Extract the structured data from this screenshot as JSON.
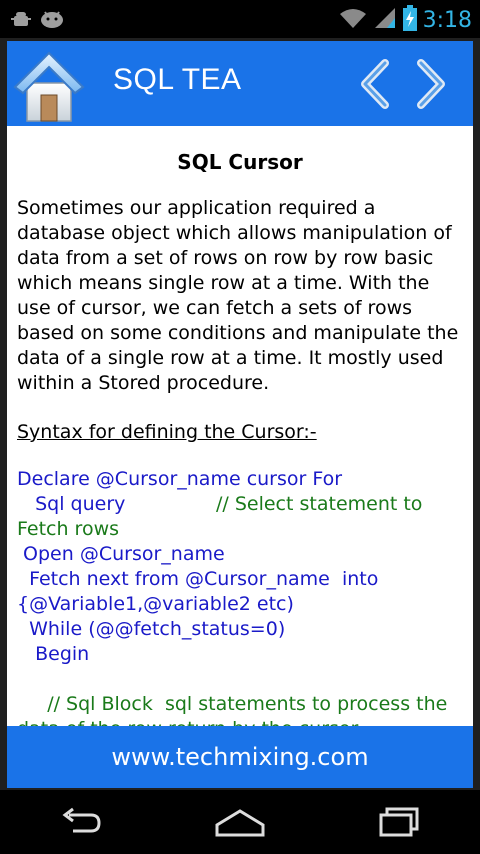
{
  "status_bar": {
    "time": "3:18",
    "icons": [
      "android-debug-icon",
      "android-icon",
      "wifi-icon",
      "signal-icon",
      "battery-charging-icon"
    ]
  },
  "header": {
    "title": "SQL TEA",
    "home_icon": "home-icon",
    "prev_icon": "chevron-left-icon",
    "next_icon": "chevron-right-icon"
  },
  "article": {
    "heading": "SQL Cursor",
    "paragraph_lines": [
      "Sometimes our application required a",
      "database object which allows manipulation of",
      "data from a set of rows on row by row basic",
      "which means single row at a time. With the",
      "use of cursor, we can fetch a sets of rows",
      "based on some conditions and manipulate the",
      "data of a single row at a time. It mostly used",
      "within a Stored procedure."
    ],
    "syntax_label": "Syntax for defining the Cursor:-",
    "code": {
      "line1": "Declare @Cursor_name cursor For",
      "line2_code": "   Sql query               ",
      "line2_comment": "// Select statement to",
      "line3_comment": "Fetch rows",
      "line4": " Open @Cursor_name",
      "line5": "  Fetch next from @Cursor_name  into",
      "line6": "{@Variable1,@variable2 etc)",
      "line7": "  While (@@fetch_status=0)",
      "line8": "   Begin",
      "line9": "",
      "line10_comment": "     // Sql Block  sql statements to process the",
      "line11_comment": "data of the row return by the cursor"
    }
  },
  "footer": {
    "link": "www.techmixing.com"
  },
  "nav_bar": {
    "icons": [
      "back-icon",
      "home-nav-icon",
      "recents-icon"
    ]
  },
  "colors": {
    "header_blue": "#1a73e8",
    "code_blue": "#1a1ac8",
    "comment_green": "#1a7a1a",
    "clock_blue": "#33b5e5"
  }
}
